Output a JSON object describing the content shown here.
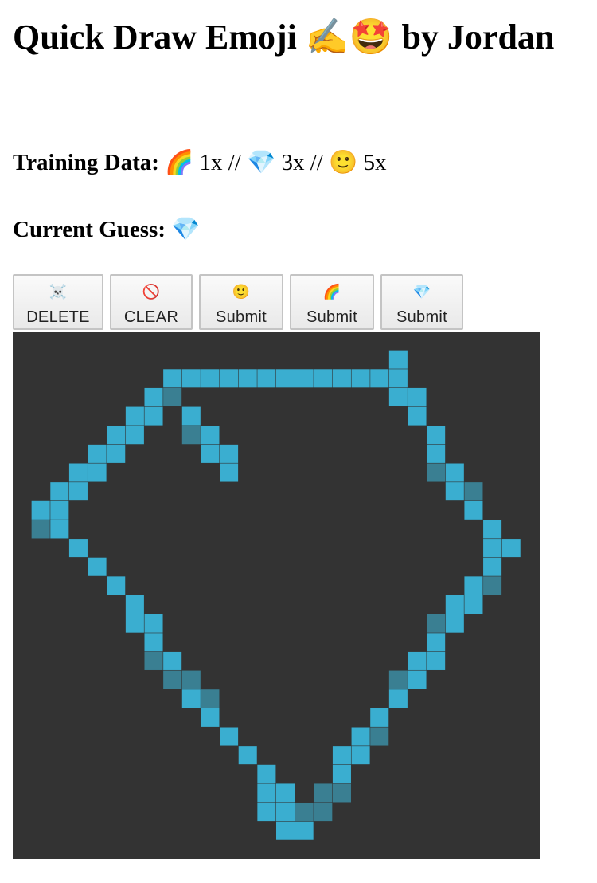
{
  "page": {
    "title": "Quick Draw Emoji ✍️🤩 by Jordan"
  },
  "training": {
    "label": "Training Data:",
    "value": "🌈 1x // 💎 3x // 🙂 5x"
  },
  "guess": {
    "label": "Current Guess:",
    "value": "💎"
  },
  "buttons": [
    {
      "icon": "☠️",
      "label": "DELETE"
    },
    {
      "icon": "🚫",
      "label": "CLEAR"
    },
    {
      "icon": "🙂",
      "label": "Submit"
    },
    {
      "icon": "🌈",
      "label": "Submit"
    },
    {
      "icon": "💎",
      "label": "Submit"
    }
  ],
  "drawing": {
    "grid_size": 28,
    "background_color": "#333333",
    "stroke_color": "#3aaed0",
    "dim_stroke_color": "#3a7f92",
    "filled_cells": [
      [
        20,
        1
      ],
      [
        8,
        2
      ],
      [
        9,
        2
      ],
      [
        10,
        2
      ],
      [
        11,
        2
      ],
      [
        12,
        2
      ],
      [
        13,
        2
      ],
      [
        14,
        2
      ],
      [
        15,
        2
      ],
      [
        16,
        2
      ],
      [
        17,
        2
      ],
      [
        18,
        2
      ],
      [
        19,
        2
      ],
      [
        20,
        2
      ],
      [
        7,
        3
      ],
      [
        8,
        3
      ],
      [
        20,
        3
      ],
      [
        21,
        3
      ],
      [
        6,
        4
      ],
      [
        7,
        4
      ],
      [
        9,
        4
      ],
      [
        21,
        4
      ],
      [
        5,
        5
      ],
      [
        6,
        5
      ],
      [
        9,
        5
      ],
      [
        10,
        5
      ],
      [
        22,
        5
      ],
      [
        4,
        6
      ],
      [
        5,
        6
      ],
      [
        10,
        6
      ],
      [
        11,
        6
      ],
      [
        22,
        6
      ],
      [
        3,
        7
      ],
      [
        4,
        7
      ],
      [
        11,
        7
      ],
      [
        22,
        7
      ],
      [
        23,
        7
      ],
      [
        2,
        8
      ],
      [
        3,
        8
      ],
      [
        23,
        8
      ],
      [
        24,
        8
      ],
      [
        1,
        9
      ],
      [
        2,
        9
      ],
      [
        24,
        9
      ],
      [
        1,
        10
      ],
      [
        2,
        10
      ],
      [
        25,
        10
      ],
      [
        3,
        11
      ],
      [
        25,
        11
      ],
      [
        26,
        11
      ],
      [
        4,
        12
      ],
      [
        25,
        12
      ],
      [
        5,
        13
      ],
      [
        24,
        13
      ],
      [
        25,
        13
      ],
      [
        6,
        14
      ],
      [
        23,
        14
      ],
      [
        24,
        14
      ],
      [
        6,
        15
      ],
      [
        7,
        15
      ],
      [
        22,
        15
      ],
      [
        23,
        15
      ],
      [
        7,
        16
      ],
      [
        22,
        16
      ],
      [
        7,
        17
      ],
      [
        8,
        17
      ],
      [
        21,
        17
      ],
      [
        22,
        17
      ],
      [
        8,
        18
      ],
      [
        9,
        18
      ],
      [
        20,
        18
      ],
      [
        21,
        18
      ],
      [
        9,
        19
      ],
      [
        10,
        19
      ],
      [
        20,
        19
      ],
      [
        10,
        20
      ],
      [
        19,
        20
      ],
      [
        11,
        21
      ],
      [
        18,
        21
      ],
      [
        19,
        21
      ],
      [
        12,
        22
      ],
      [
        17,
        22
      ],
      [
        18,
        22
      ],
      [
        13,
        23
      ],
      [
        17,
        23
      ],
      [
        13,
        24
      ],
      [
        14,
        24
      ],
      [
        16,
        24
      ],
      [
        17,
        24
      ],
      [
        13,
        25
      ],
      [
        14,
        25
      ],
      [
        15,
        25
      ],
      [
        16,
        25
      ],
      [
        14,
        26
      ],
      [
        15,
        26
      ]
    ],
    "dim_cells": [
      [
        8,
        3
      ],
      [
        9,
        5
      ],
      [
        22,
        7
      ],
      [
        24,
        8
      ],
      [
        1,
        10
      ],
      [
        25,
        13
      ],
      [
        22,
        15
      ],
      [
        7,
        17
      ],
      [
        8,
        18
      ],
      [
        9,
        18
      ],
      [
        10,
        19
      ],
      [
        20,
        18
      ],
      [
        19,
        21
      ],
      [
        12,
        24
      ],
      [
        16,
        24
      ],
      [
        17,
        24
      ],
      [
        15,
        25
      ],
      [
        16,
        25
      ]
    ]
  }
}
